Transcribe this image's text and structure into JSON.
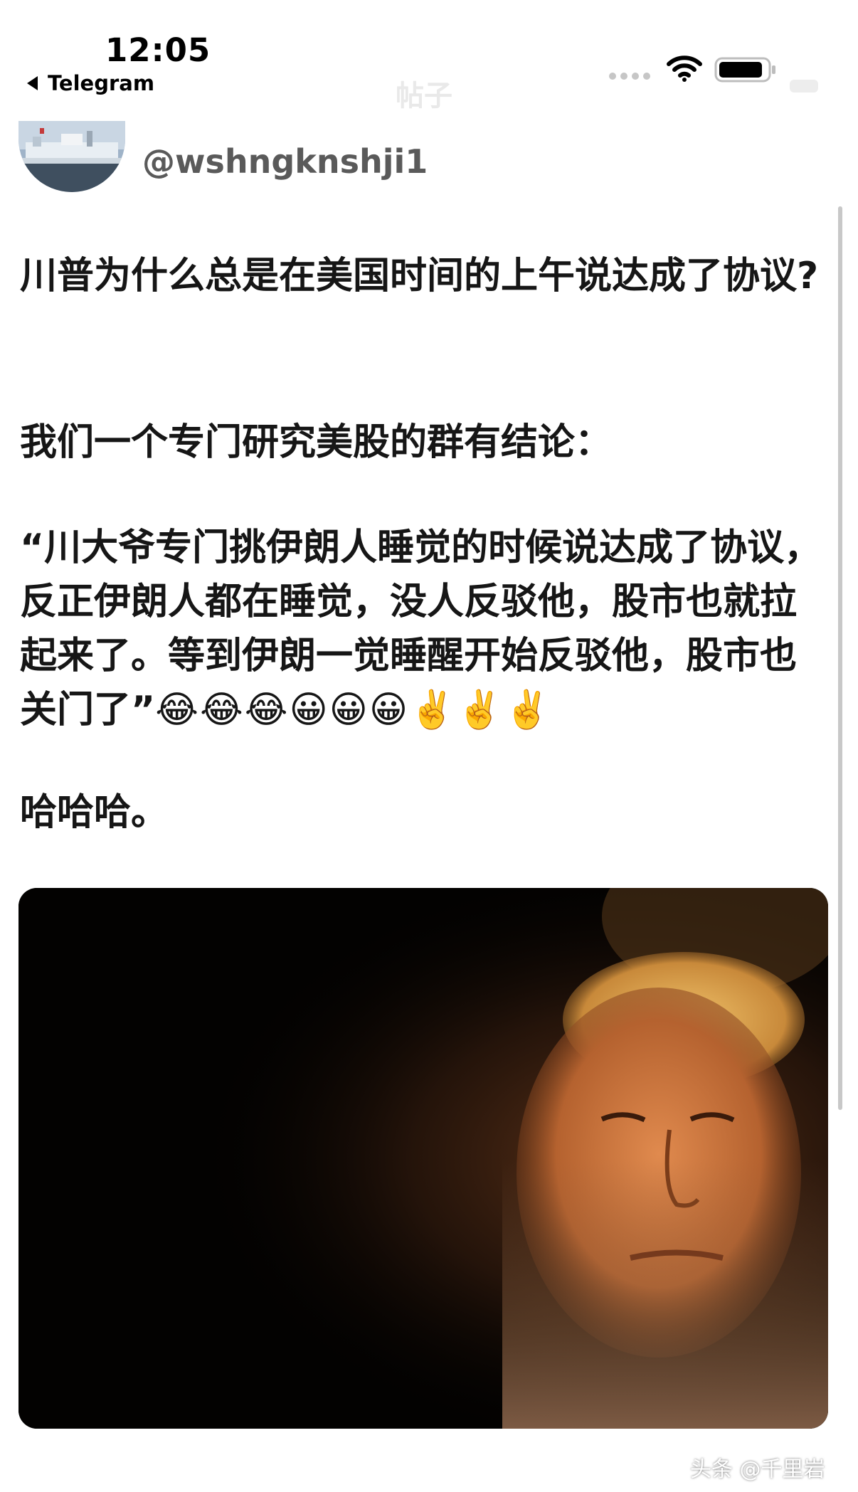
{
  "status_bar": {
    "time": "12:05",
    "back_app": "Telegram",
    "ghost_title": "帖子"
  },
  "post": {
    "handle": "@wshngknshji1",
    "paragraph_1": "川普为什么总是在美国时间的上午说达成了协议?",
    "paragraph_2": "我们一个专门研究美股的群有结论：",
    "paragraph_3": "“川大爷专门挑伊朗人睡觉的时候说达成了协议，反正伊朗人都在睡觉，没人反驳他，股市也就拉起来了。等到伊朗一觉睡醒开始反驳他，股市也关门了”",
    "paragraph_3_emojis": "😂😂😂😀😀😀✌️✌️✌️",
    "paragraph_4": "哈哈哈。"
  },
  "watermark": "头条 @千里岩",
  "icons": [
    "back-arrow-icon",
    "wifi-icon",
    "battery-icon",
    "avatar-image",
    "post-photo"
  ],
  "colors": {
    "handle": "#5a5a5a",
    "text": "#161616",
    "photo_bg": "#000000",
    "face_tone": "#c8723e",
    "hair_tone": "#d9a24a"
  }
}
